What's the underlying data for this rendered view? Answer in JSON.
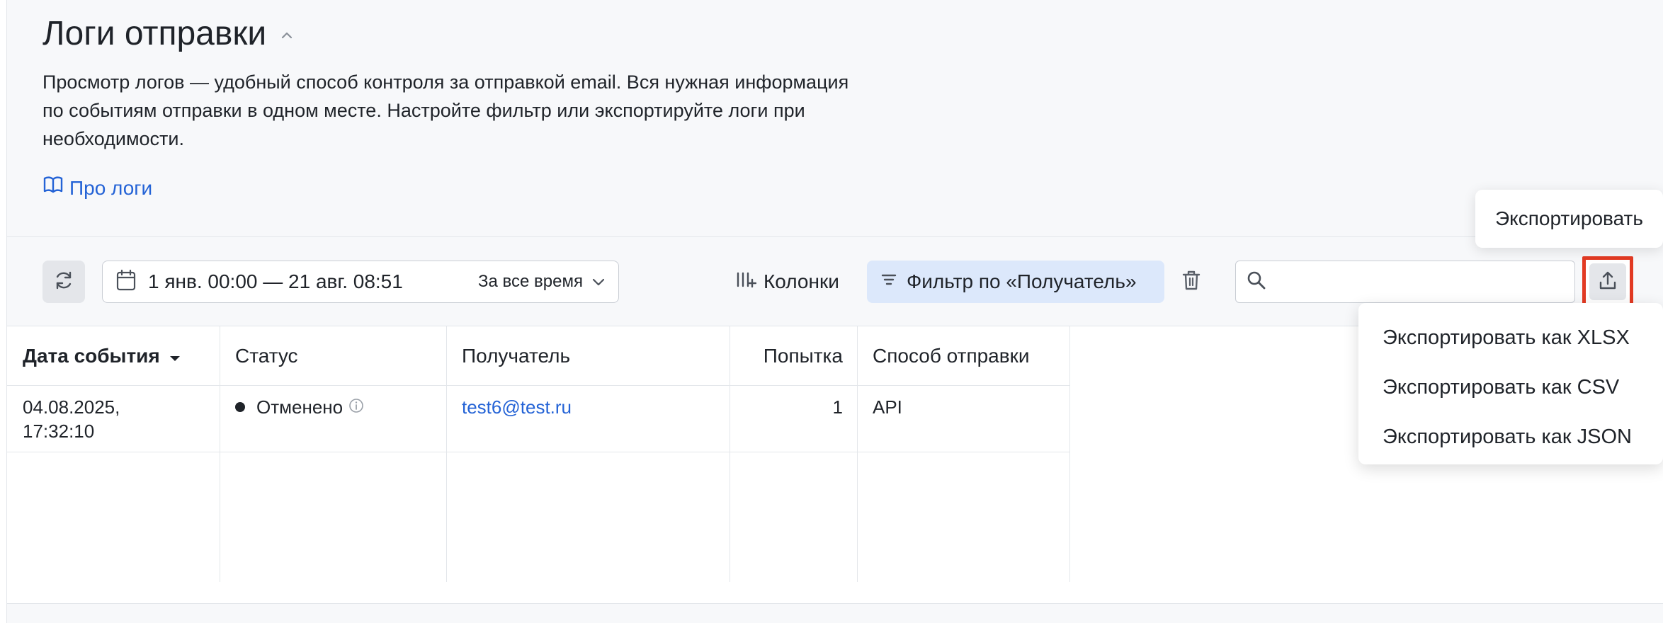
{
  "header": {
    "title": "Логи отправки",
    "description": "Просмотр логов — удобный способ контроля за отправкой email. Вся нужная информация по событиям отправки в одном месте. Настройте фильтр или экспортируйте логи при необходимости.",
    "about_link": "Про логи"
  },
  "toolbar": {
    "date_range": "1 янв. 00:00 — 21 авг. 08:51",
    "period": "За все время",
    "columns_label": "Колонки",
    "filter_label": "Фильтр по «Получатель»",
    "search": {
      "value": "",
      "placeholder": ""
    },
    "export_tooltip": "Экспортировать"
  },
  "export_menu": {
    "items": [
      {
        "label": "Экспортировать как XLSX"
      },
      {
        "label": "Экспортировать как CSV"
      },
      {
        "label": "Экспортировать как JSON"
      }
    ]
  },
  "table": {
    "columns": [
      {
        "label": "Дата события",
        "sorted": "desc"
      },
      {
        "label": "Статус"
      },
      {
        "label": "Получатель"
      },
      {
        "label": "Попытка"
      },
      {
        "label": "Способ отправки"
      }
    ],
    "rows": [
      {
        "date_line1": "04.08.2025,",
        "date_line2": "17:32:10",
        "status": "Отменено",
        "recipient": "test6@test.ru",
        "attempt": "1",
        "method": "API"
      }
    ]
  },
  "colors": {
    "accent": "#2463d6",
    "filter_bg": "#dce8fb",
    "highlight_border": "#e23a23",
    "text": "#1f2329"
  }
}
